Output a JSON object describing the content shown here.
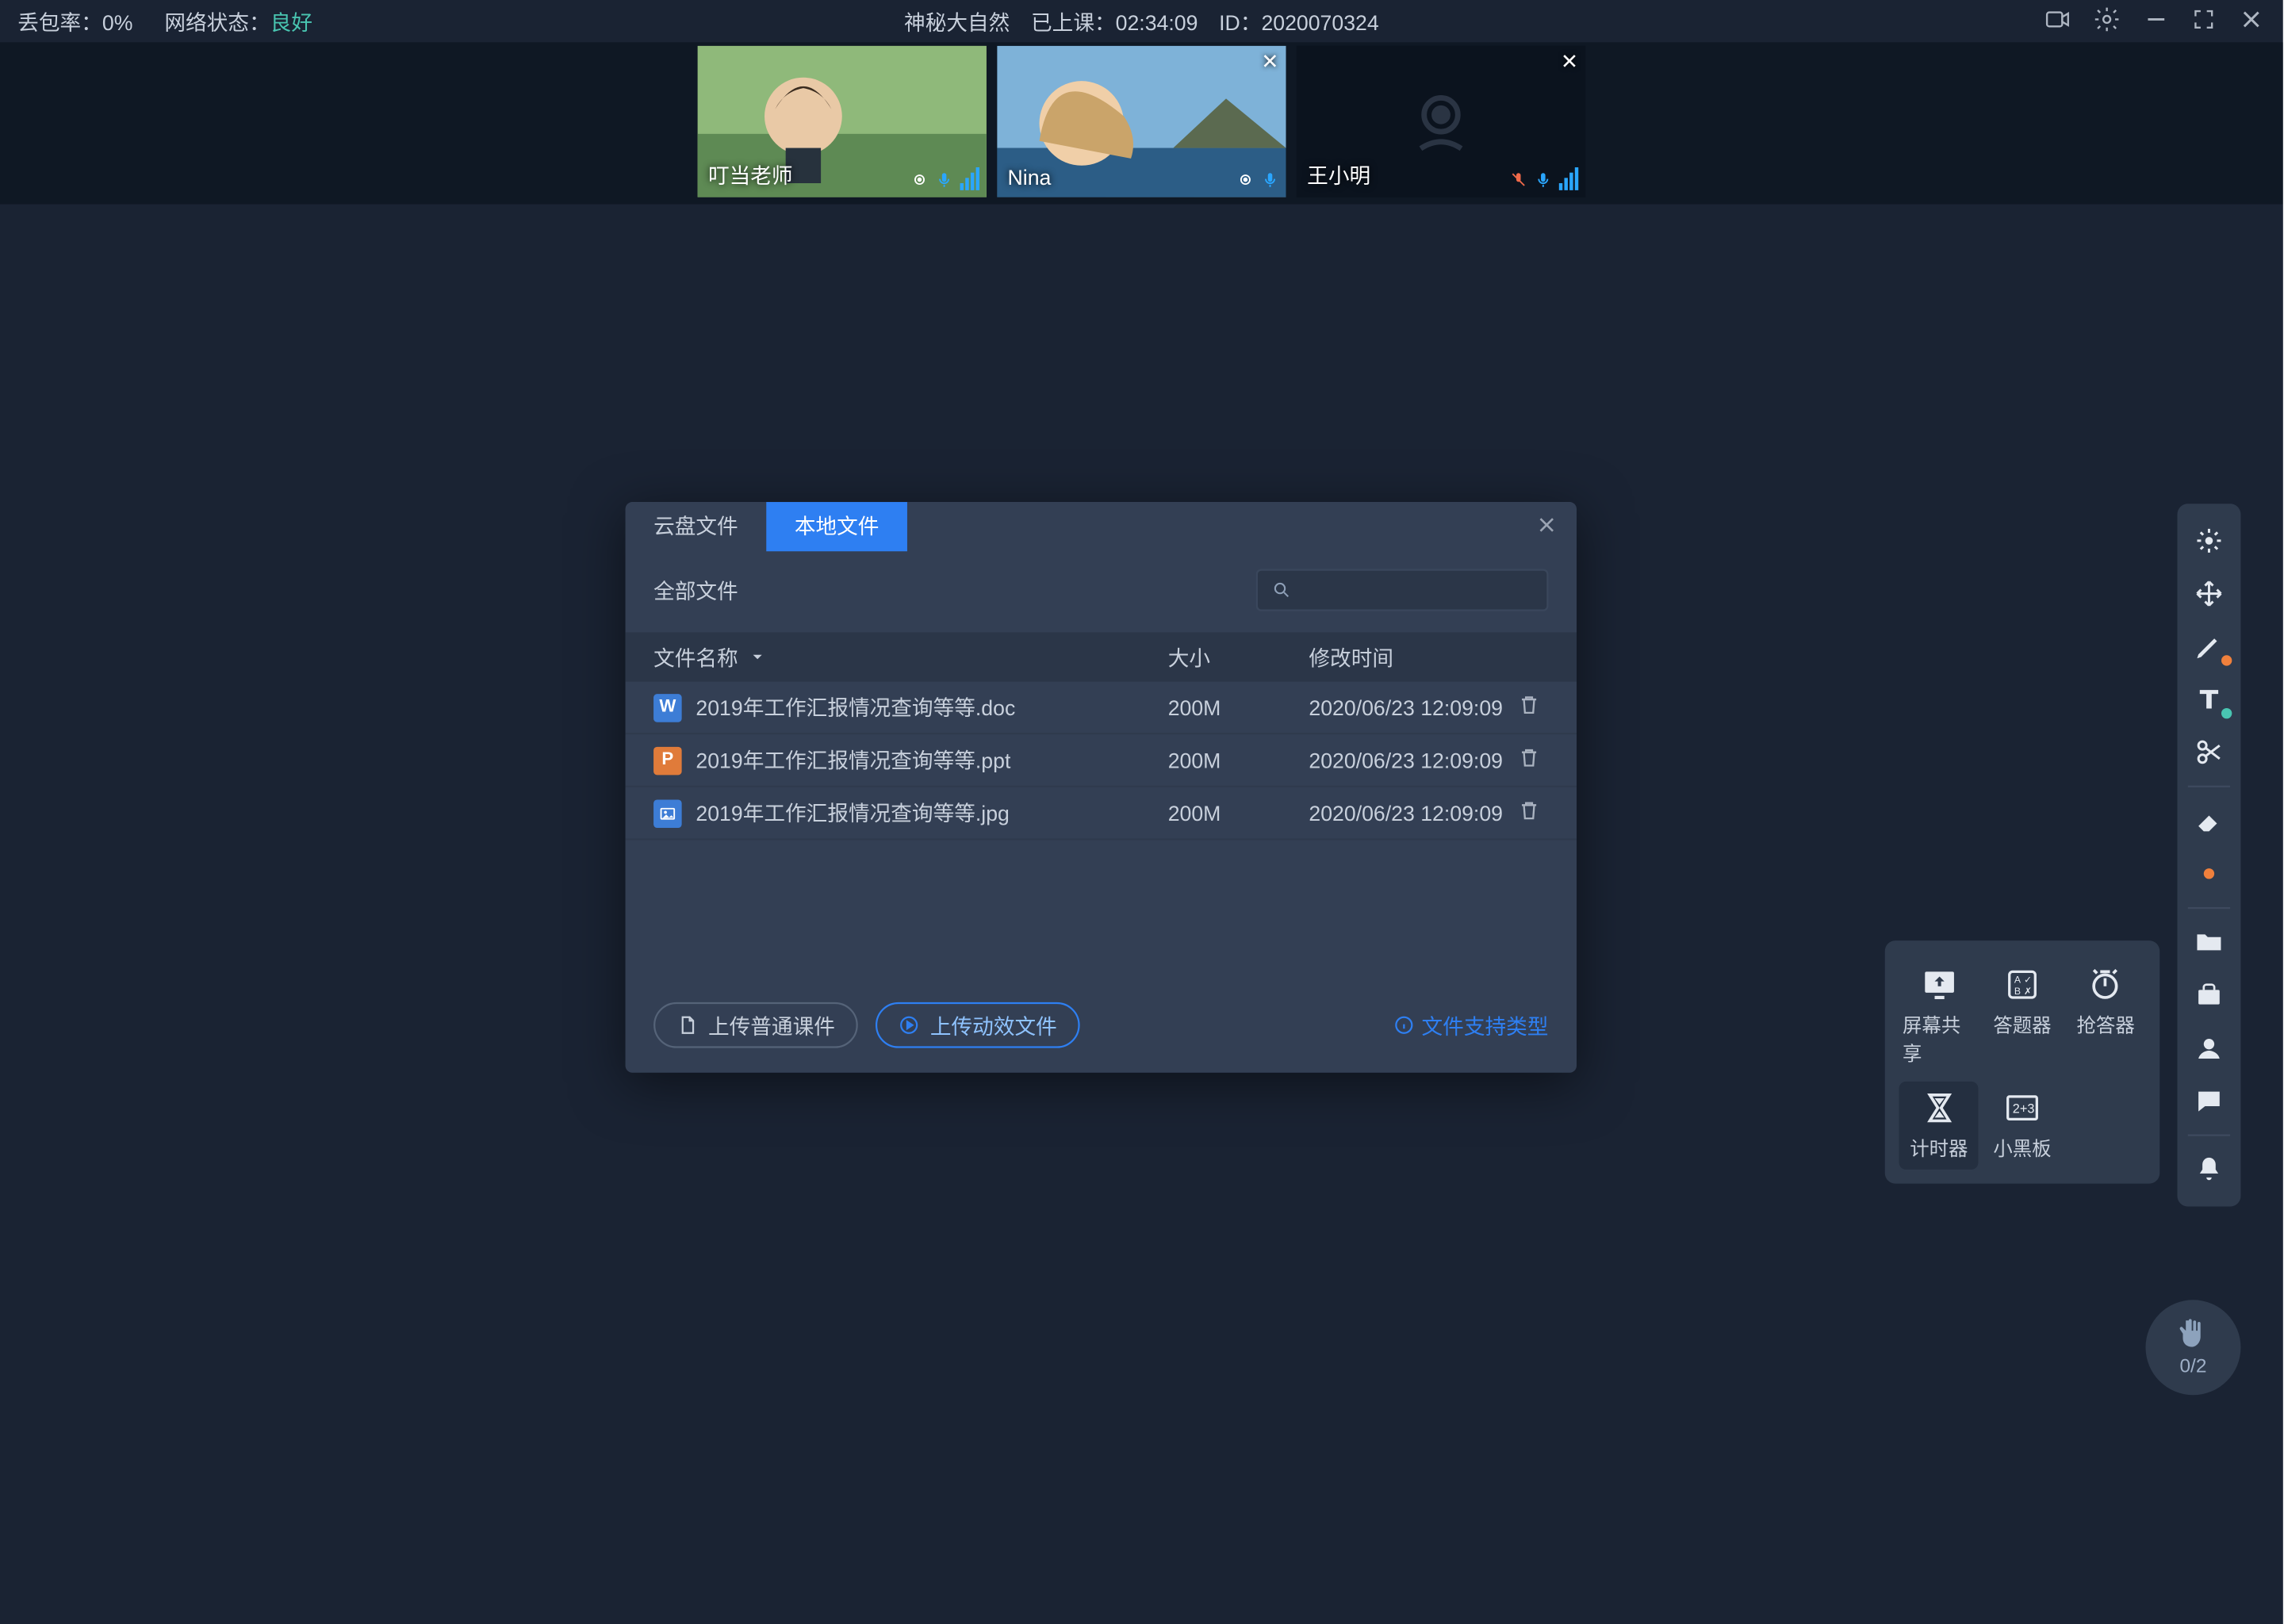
{
  "status": {
    "loss_label": "丢包率：",
    "loss_value": "0%",
    "net_label": "网络状态：",
    "net_value": "良好",
    "title": "神秘大自然",
    "elapsed_label": "已上课：",
    "elapsed_value": "02:34:09",
    "id_label": "ID：",
    "id_value": "2020070324"
  },
  "participants": [
    {
      "name": "叮当老师",
      "has_close": false,
      "mic_muted": false,
      "camera_on": true
    },
    {
      "name": "Nina",
      "has_close": true,
      "mic_muted": false,
      "camera_on": true
    },
    {
      "name": "王小明",
      "has_close": true,
      "mic_muted": true,
      "camera_on": false
    }
  ],
  "dialog": {
    "tabs": [
      "云盘文件",
      "本地文件"
    ],
    "active_tab": 1,
    "all_files_label": "全部文件",
    "columns": {
      "name": "文件名称",
      "size": "大小",
      "mtime": "修改时间"
    },
    "files": [
      {
        "icon": "doc",
        "letter": "W",
        "name": "2019年工作汇报情况查询等等.doc",
        "size": "200M",
        "mtime": "2020/06/23 12:09:09"
      },
      {
        "icon": "ppt",
        "letter": "P",
        "name": "2019年工作汇报情况查询等等.ppt",
        "size": "200M",
        "mtime": "2020/06/23 12:09:09"
      },
      {
        "icon": "jpg",
        "letter": "",
        "name": "2019年工作汇报情况查询等等.jpg",
        "size": "200M",
        "mtime": "2020/06/23 12:09:09"
      }
    ],
    "upload_normal": "上传普通课件",
    "upload_dynamic": "上传动效文件",
    "support_link": "文件支持类型"
  },
  "tools_popup": {
    "items": [
      {
        "id": "screenshare",
        "label": "屏幕共享"
      },
      {
        "id": "answer",
        "label": "答题器"
      },
      {
        "id": "responder",
        "label": "抢答器"
      },
      {
        "id": "timer",
        "label": "计时器",
        "selected": true
      },
      {
        "id": "blackboard",
        "label": "小黑板"
      }
    ]
  },
  "hand": {
    "count": "0/2"
  }
}
